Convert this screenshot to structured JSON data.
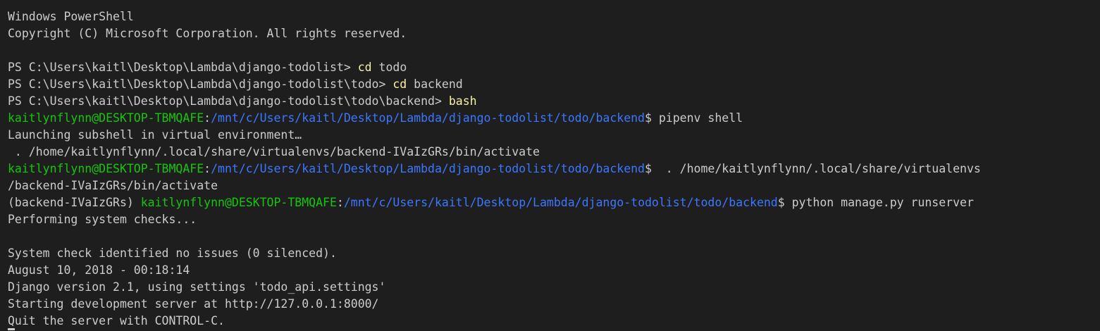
{
  "window": {
    "app": "Windows PowerShell"
  },
  "colors": {
    "background": "#1e1e1e",
    "text": "#cccccc",
    "command": "#f9f1a5",
    "user_host": "#16c60c",
    "path": "#3b78ff"
  },
  "lines": [
    [
      {
        "text": "Windows PowerShell",
        "style": "default"
      }
    ],
    [
      {
        "text": "Copyright (C) Microsoft Corporation. All rights reserved.",
        "style": "default"
      }
    ],
    [
      {
        "text": "",
        "style": "default"
      }
    ],
    [
      {
        "text": "PS C:\\Users\\kaitl\\Desktop\\Lambda\\django-todolist> ",
        "style": "default"
      },
      {
        "text": "cd",
        "style": "cmd"
      },
      {
        "text": " todo",
        "style": "default"
      }
    ],
    [
      {
        "text": "PS C:\\Users\\kaitl\\Desktop\\Lambda\\django-todolist\\todo> ",
        "style": "default"
      },
      {
        "text": "cd",
        "style": "cmd"
      },
      {
        "text": " backend",
        "style": "default"
      }
    ],
    [
      {
        "text": "PS C:\\Users\\kaitl\\Desktop\\Lambda\\django-todolist\\todo\\backend> ",
        "style": "default"
      },
      {
        "text": "bash",
        "style": "cmd"
      }
    ],
    [
      {
        "text": "kaitlynflynn@DESKTOP-TBMQAFE",
        "style": "green"
      },
      {
        "text": ":",
        "style": "default"
      },
      {
        "text": "/mnt/c/Users/kaitl/Desktop/Lambda/django-todolist/todo/backend",
        "style": "blue"
      },
      {
        "text": "$ pipenv shell",
        "style": "default"
      }
    ],
    [
      {
        "text": "Launching subshell in virtual environment…",
        "style": "default"
      }
    ],
    [
      {
        "text": " . /home/kaitlynflynn/.local/share/virtualenvs/backend-IVaIzGRs/bin/activate",
        "style": "default"
      }
    ],
    [
      {
        "text": "kaitlynflynn@DESKTOP-TBMQAFE",
        "style": "green"
      },
      {
        "text": ":",
        "style": "default"
      },
      {
        "text": "/mnt/c/Users/kaitl/Desktop/Lambda/django-todolist/todo/backend",
        "style": "blue"
      },
      {
        "text": "$  . /home/kaitlynflynn/.local/share/virtualenvs",
        "style": "default"
      }
    ],
    [
      {
        "text": "/backend-IVaIzGRs/bin/activate",
        "style": "default"
      }
    ],
    [
      {
        "text": "(backend-IVaIzGRs) ",
        "style": "default"
      },
      {
        "text": "kaitlynflynn@DESKTOP-TBMQAFE",
        "style": "green"
      },
      {
        "text": ":",
        "style": "default"
      },
      {
        "text": "/mnt/c/Users/kaitl/Desktop/Lambda/django-todolist/todo/backend",
        "style": "blue"
      },
      {
        "text": "$ python manage.py runserver",
        "style": "default"
      }
    ],
    [
      {
        "text": "Performing system checks...",
        "style": "default"
      }
    ],
    [
      {
        "text": "",
        "style": "default"
      }
    ],
    [
      {
        "text": "System check identified no issues (0 silenced).",
        "style": "default"
      }
    ],
    [
      {
        "text": "August 10, 2018 - 00:18:14",
        "style": "default"
      }
    ],
    [
      {
        "text": "Django version 2.1, using settings 'todo_api.settings'",
        "style": "default"
      }
    ],
    [
      {
        "text": "Starting development server at http://127.0.0.1:8000/",
        "style": "default"
      }
    ],
    [
      {
        "text": "Quit the server with CONTROL-C.",
        "style": "default"
      }
    ]
  ]
}
